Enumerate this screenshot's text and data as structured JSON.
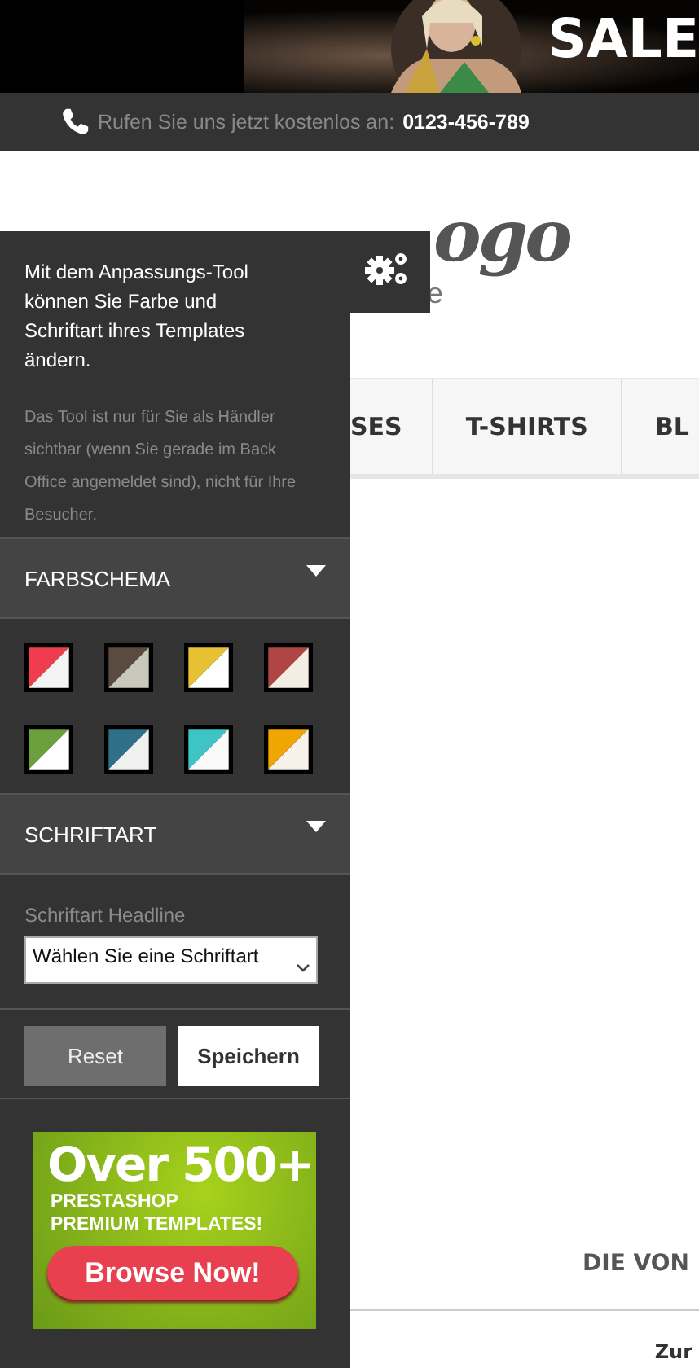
{
  "banner": {
    "kind": "picture",
    "title": "SALE"
  },
  "contact": {
    "label": "Rufen Sie uns jetzt kostenlos an:",
    "phone": "0123-456-789"
  },
  "logo": {
    "visible_text": "ogo",
    "tagline_fragment": "e"
  },
  "nav": [
    {
      "label": "SES"
    },
    {
      "label": "T-SHIRTS"
    },
    {
      "label": "BL"
    }
  ],
  "content": {
    "heading": "DIE VON",
    "link": "Zur"
  },
  "customizer": {
    "intro": "Mit dem Anpassungs-Tool können Sie Farbe und Schriftart ihres Templates ändern.",
    "note": "Das Tool ist nur für Sie als Händler sichtbar (wenn Sie gerade im Back Office angemeldet sind), nicht für Ihre Besucher.",
    "color_section": {
      "title": "FARBSCHEMA"
    },
    "swatches": [
      {
        "color": "#ef3c4e",
        "accent": {
          "color": "#f3f3f3"
        }
      },
      {
        "color": "#5a4a40",
        "accent": {
          "color": "#c9c8bb"
        }
      },
      {
        "color": "#e8c132",
        "accent": {
          "color": "#ffffff"
        }
      },
      {
        "color": "#b04545",
        "accent": {
          "color": "#f3ede4"
        }
      },
      {
        "color": "#6a9f3b",
        "accent": {
          "color": "#ffffff"
        }
      },
      {
        "color": "#2e7088",
        "accent": {
          "color": "#f0f0f0"
        }
      },
      {
        "color": "#3ec4c4",
        "accent": {
          "color": "#fafafa"
        }
      },
      {
        "color": "#f0a500",
        "accent": {
          "color": "#f6f2ea"
        }
      }
    ],
    "font_section": {
      "title": "SCHRIFTART"
    },
    "font_field": {
      "label": "Schriftart Headline",
      "value": "Wählen Sie eine Schriftart"
    },
    "buttons": [
      {
        "label": "Reset",
        "kind": "secondary"
      },
      {
        "label": "Speichern",
        "kind": "primary"
      }
    ],
    "promo": {
      "headline": "Over 500+",
      "line_1": "PRESTASHOP",
      "line_2": "PREMIUM TEMPLATES!",
      "cta": "Browse Now!"
    }
  }
}
